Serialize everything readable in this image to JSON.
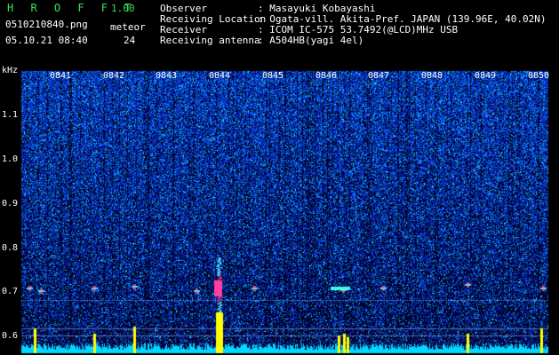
{
  "app": {
    "title": "H R O F F T",
    "version": "1.00",
    "filename": "0510210840.png",
    "datetime": "05.10.21 08:40",
    "meteor_label": "meteor",
    "meteor_count": "24"
  },
  "header": {
    "fields": [
      {
        "label": "Observer",
        "value": ": Masayuki Kobayashi"
      },
      {
        "label": "Receiving Location",
        "value": ": Ogata-vill. Akita-Pref. JAPAN (139.96E, 40.02N)"
      },
      {
        "label": "Receiver",
        "value": ": ICOM IC-575 53.7492(@LCD)MHz USB"
      },
      {
        "label": "Receiving antenna",
        "value": ": A504HB(yagi 4el)"
      }
    ]
  },
  "spectrogram": {
    "unit_label": "kHz",
    "y_ticks": [
      "1.1",
      "1.0",
      "0.9",
      "0.8",
      "0.7",
      "0.6"
    ],
    "x_ticks": [
      "0841",
      "0842",
      "0843",
      "0844",
      "0845",
      "0846",
      "0847",
      "0848",
      "0849",
      "0850"
    ],
    "colors": {
      "background": "#000030",
      "noise": "#1a3cff",
      "strong": "#ff2050",
      "signal": "#ffff00",
      "floor": "#00e5ff"
    }
  }
}
